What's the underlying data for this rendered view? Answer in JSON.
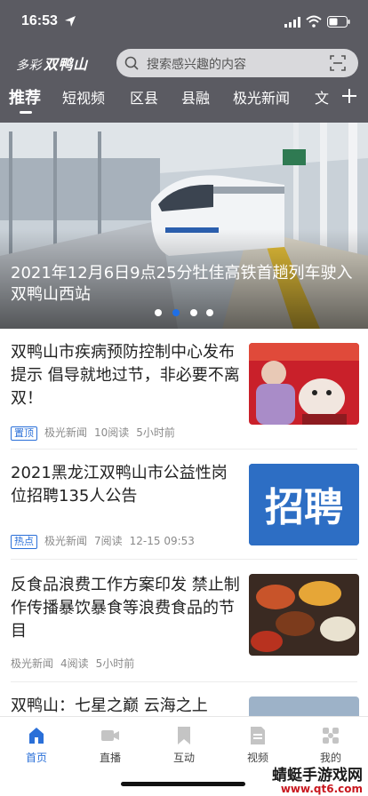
{
  "status_bar": {
    "time": "16:53"
  },
  "header": {
    "brand_prefix": "多彩",
    "brand_name": "双鸭山",
    "search_placeholder": "搜索感兴趣的内容",
    "tabs": [
      {
        "label": "推荐",
        "active": true
      },
      {
        "label": "短视频",
        "active": false
      },
      {
        "label": "区县",
        "active": false
      },
      {
        "label": "县融",
        "active": false
      },
      {
        "label": "极光新闻",
        "active": false
      },
      {
        "label": "文",
        "active": false
      }
    ]
  },
  "banner": {
    "title": "2021年12月6日9点25分牡佳高铁首趟列车驶入双鸭山西站",
    "dot_count": 4,
    "active_dot": 1
  },
  "news": [
    {
      "title": "双鸭山市疾病预防控制中心发布提示 倡导就地过节，非必要不离双！",
      "tag": "置顶",
      "source": "极光新闻",
      "reads": "10阅读",
      "time": "5小时前"
    },
    {
      "title": "2021黑龙江双鸭山市公益性岗位招聘135人公告",
      "tag": "热点",
      "source": "极光新闻",
      "reads": "7阅读",
      "time": "12-15 09:53",
      "thumb_text": "招聘"
    },
    {
      "title": "反食品浪费工作方案印发 禁止制作传播暴饮暴食等浪费食品的节目",
      "tag": "",
      "source": "极光新闻",
      "reads": "4阅读",
      "time": "5小时前"
    },
    {
      "title": "双鸭山：七星之巅 云海之上"
    }
  ],
  "bottom_nav": [
    {
      "label": "首页",
      "icon": "home-icon",
      "active": true
    },
    {
      "label": "直播",
      "icon": "live-camera-icon",
      "active": false
    },
    {
      "label": "互动",
      "icon": "bookmark-icon",
      "active": false
    },
    {
      "label": "视频",
      "icon": "video-doc-icon",
      "active": false
    },
    {
      "label": "我的",
      "icon": "profile-icon",
      "active": false
    }
  ],
  "watermark": {
    "line1": "蜻蜓手游戏网",
    "line2": "www.qt6.com"
  },
  "colors": {
    "header_bg": "#5b5b62",
    "accent": "#2a6fd8",
    "active_dot": "#1f6fe6"
  }
}
